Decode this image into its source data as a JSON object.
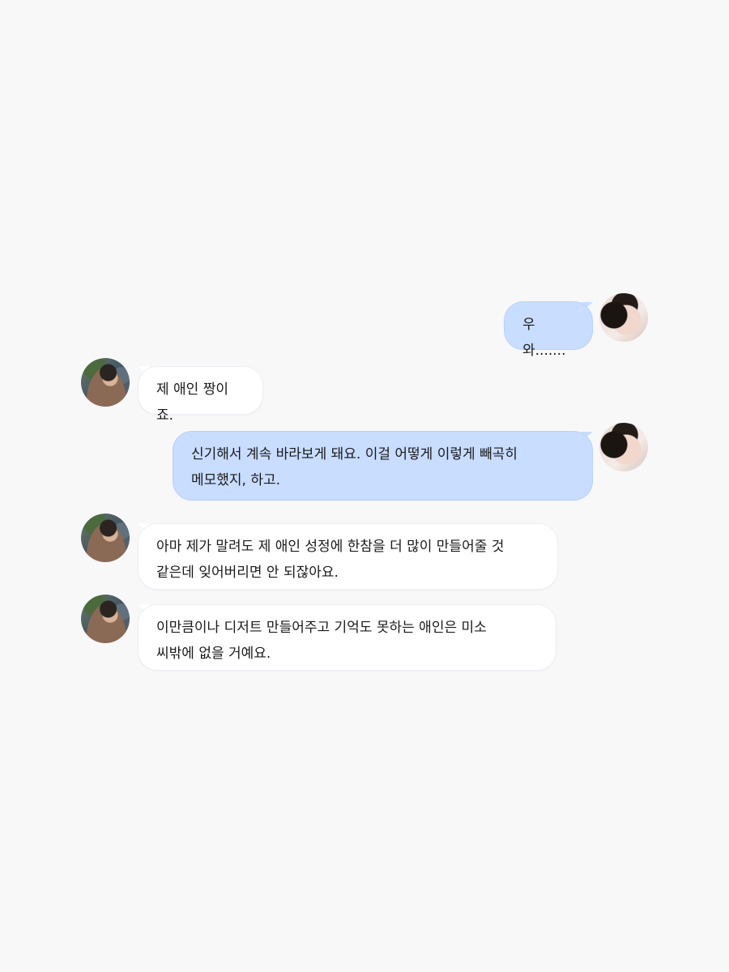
{
  "conversation": {
    "messages": [
      {
        "sender": "me",
        "avatar": "woman-avatar",
        "text": "우와......."
      },
      {
        "sender": "other",
        "avatar": "man-avatar",
        "text": "제 애인 짱이죠."
      },
      {
        "sender": "me",
        "avatar": "woman-avatar",
        "text": "신기해서 계속 바라보게 돼요. 이걸 어떻게 이렇게 빼곡히\n메모했지, 하고."
      },
      {
        "sender": "other",
        "avatar": "man-avatar",
        "text": "아마 제가 말려도 제 애인 성정에 한참을 더 많이 만들어줄 것\n같은데 잊어버리면 안 되잖아요."
      },
      {
        "sender": "other",
        "avatar": "man-avatar",
        "text": "이만큼이나 디저트 만들어주고 기억도 못하는 애인은 미소\n씨밖에 없을 거예요."
      }
    ]
  },
  "theme": {
    "background": "#f8f8f9",
    "my_bubble": "#c8ddff",
    "other_bubble": "#ffffff"
  }
}
